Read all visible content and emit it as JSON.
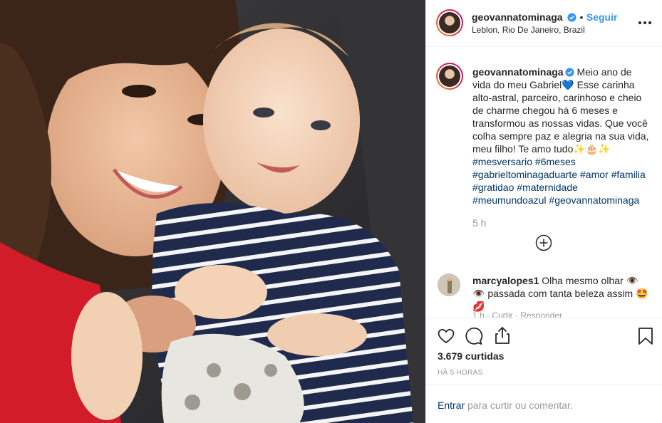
{
  "post": {
    "username": "geovannatominaga",
    "follow_label": "Seguir",
    "separator": "•",
    "location": "Leblon, Rio De Janeiro, Brazil"
  },
  "caption": {
    "username": "geovannatominaga",
    "text": "Meio ano de vida do meu Gabriel💙 Esse carinha alto-astral, parceiro, carinhoso e cheio de charme chegou há 6 meses e transformou as nossas vidas. Que você colha sempre paz e alegria na sua vida, meu filho! Te amo tudo✨🎂✨",
    "hashtags": [
      "#mesversario",
      "#6meses",
      "#gabrieltominagaduarte",
      "#amor",
      "#familia",
      "#gratidao",
      "#maternidade",
      "#meumundoazul",
      "#geovannatominaga"
    ],
    "time": "5 h"
  },
  "comment": {
    "username": "marcyalopes1",
    "text": "Olha mesmo olhar 👁️👁️ passada com tanta beleza assim 🤩💋",
    "cutoff": "1 h · Curtir · Responder"
  },
  "stats": {
    "likes": "3.679 curtidas",
    "posted_ago": "HÁ 5 HORAS"
  },
  "login": {
    "link": "Entrar",
    "rest": " para curtir ou comentar."
  },
  "icons": {
    "verified": "verified-badge-icon",
    "more": "more-options-icon",
    "load_more": "plus-circle-icon",
    "like": "heart-icon",
    "comment": "comment-icon",
    "share": "share-icon",
    "save": "bookmark-icon"
  },
  "colors": {
    "link_blue": "#3897f0",
    "hashtag": "#003569",
    "verified": "#3897f0",
    "muted": "#999999"
  }
}
